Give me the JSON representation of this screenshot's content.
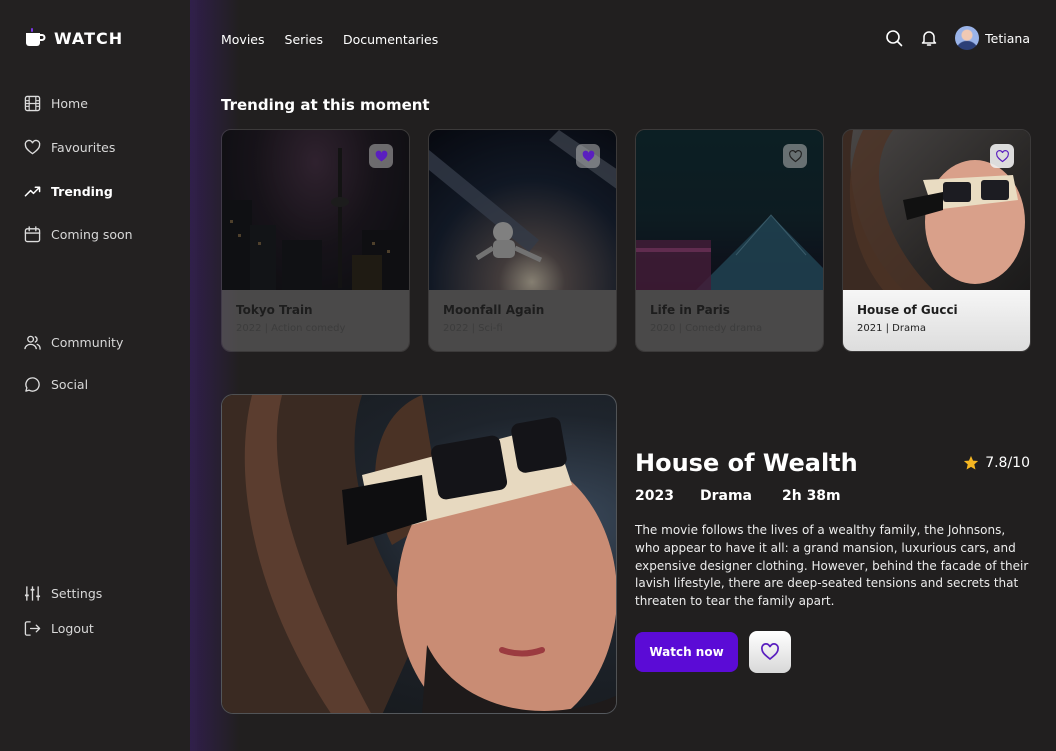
{
  "app": {
    "logo_text": "WATCH"
  },
  "sidebar": {
    "items": [
      {
        "label": "Home",
        "icon": "film-icon"
      },
      {
        "label": "Favourites",
        "icon": "heart-icon"
      },
      {
        "label": "Trending",
        "icon": "trending-icon",
        "active": true
      },
      {
        "label": "Coming soon",
        "icon": "calendar-icon"
      },
      {
        "label": "Community",
        "icon": "users-icon"
      },
      {
        "label": "Social",
        "icon": "chat-icon"
      },
      {
        "label": "Settings",
        "icon": "sliders-icon"
      },
      {
        "label": "Logout",
        "icon": "logout-icon"
      }
    ]
  },
  "topnav": {
    "items": [
      "Movies",
      "Series",
      "Documentaries"
    ]
  },
  "user": {
    "name": "Tetiana"
  },
  "trending": {
    "title": "Trending at this moment",
    "cards": [
      {
        "name": "Tokyo Train",
        "meta": "2022 | Action comedy"
      },
      {
        "name": "Moonfall Again",
        "meta": "2022 | Sci-fi"
      },
      {
        "name": "Life in Paris",
        "meta": "2020 | Comedy drama"
      },
      {
        "name": "House of Gucci",
        "meta": "2021 | Drama"
      }
    ]
  },
  "detail": {
    "title": "House of Wealth",
    "rating": "7.8/10",
    "year": "2023",
    "genre": "Drama",
    "duration": "2h 38m",
    "description": "The movie follows the lives of a wealthy family, the Johnsons, who appear to have it all: a grand mansion, luxurious cars, and expensive designer clothing. However, behind the facade of their lavish lifestyle, there are deep-seated tensions and secrets that threaten to tear the family apart.",
    "watch_label": "Watch now"
  },
  "colors": {
    "accent": "#5b0bd6",
    "star": "#f5b622",
    "heart": "#6a2bd8"
  }
}
